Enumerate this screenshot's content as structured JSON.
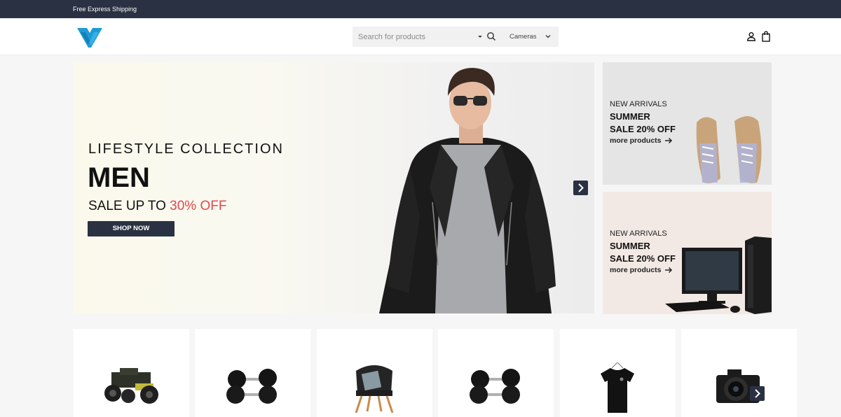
{
  "topbar": {
    "text": "Free Express Shipping"
  },
  "header": {
    "logo": "logo-icon",
    "search": {
      "placeholder": "Search for products",
      "category": "Cameras"
    },
    "icons": [
      "user-icon",
      "shopping-bag-icon"
    ]
  },
  "hero": {
    "subtitle": "LIFESTYLE COLLECTION",
    "title": "MEN",
    "sale_prefix": "SALE UP TO ",
    "sale_highlight": "30% OFF",
    "button": "SHOP NOW",
    "accent_color": "#e0484b"
  },
  "promos": [
    {
      "label": "NEW ARRIVALS",
      "line1": "SUMMER",
      "line2": "SALE 20% OFF",
      "link": "more products",
      "image": "sneakers"
    },
    {
      "label": "NEW ARRIVALS",
      "line1": "SUMMER",
      "line2": "SALE 20% OFF",
      "link": "more products",
      "image": "desktop-computer"
    }
  ],
  "products": [
    {
      "image": "rc-car-toy"
    },
    {
      "image": "dumbbells"
    },
    {
      "image": "chair"
    },
    {
      "image": "dumbbells"
    },
    {
      "image": "black-tshirt"
    },
    {
      "image": "camera"
    }
  ],
  "colors": {
    "dark": "#2a3142",
    "accent": "#e0484b",
    "logo": "#1e9bd7"
  }
}
